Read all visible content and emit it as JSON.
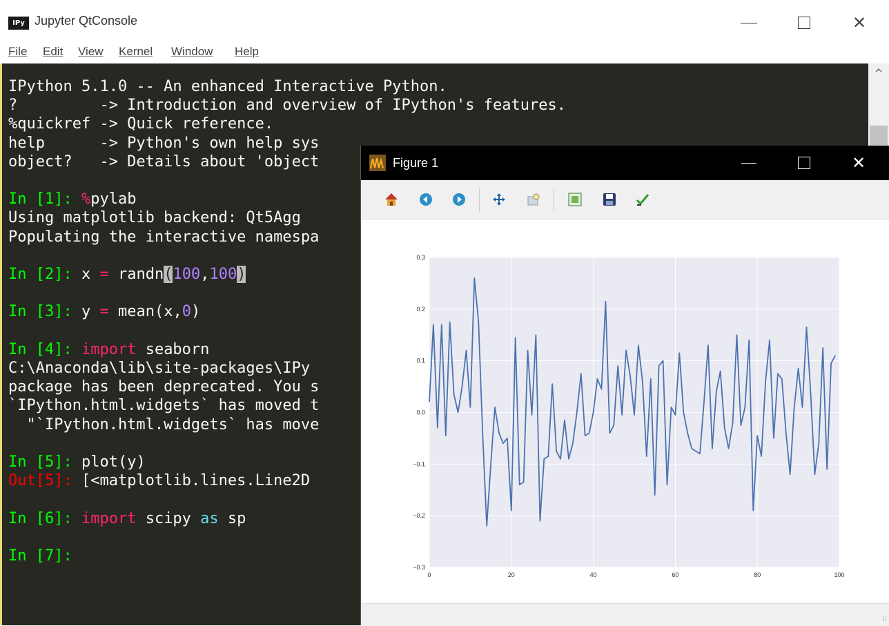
{
  "qtconsole": {
    "title": "Jupyter QtConsole",
    "icon_text": "IPy",
    "menu": [
      "File",
      "Edit",
      "View",
      "Kernel",
      "Window",
      "Help"
    ]
  },
  "console": {
    "banner": [
      "IPython 5.1.0 -- An enhanced Interactive Python.",
      "?         -> Introduction and overview of IPython's features.",
      "%quickref -> Quick reference.",
      "help      -> Python's own help sys",
      "object?   -> Details about 'object"
    ],
    "in1": {
      "prompt": "In [1]: ",
      "magic": "%",
      "code": "pylab"
    },
    "out1": [
      "Using matplotlib backend: Qt5Agg",
      "Populating the interactive namespa"
    ],
    "in2": {
      "prompt": "In [2]: ",
      "var": "x",
      "op": "=",
      "func": "randn",
      "lparen": "(",
      "a": "100",
      "comma": ",",
      "b": "100",
      "rparen": ")"
    },
    "in3": {
      "prompt": "In [3]: ",
      "var": "y",
      "op": "=",
      "call": "mean(x,",
      "arg": "0",
      "close": ")"
    },
    "in4": {
      "prompt": "In [4]: ",
      "kw": "import",
      "mod": " seaborn"
    },
    "out4": [
      "C:\\Anaconda\\lib\\site-packages\\IPy",
      "package has been deprecated. You s",
      "`IPython.html.widgets` has moved t",
      "  \"`IPython.html.widgets` has move"
    ],
    "in5": {
      "prompt": "In [5]: ",
      "code": "plot(y)"
    },
    "out5": {
      "prompt": "Out[5]: ",
      "text": "[<matplotlib.lines.Line2D"
    },
    "in6": {
      "prompt": "In [6]: ",
      "kw": "import",
      "mod": " scipy ",
      "as": "as",
      "alias": " sp"
    },
    "in7": {
      "prompt": "In [7]: "
    }
  },
  "figure": {
    "title": "Figure 1",
    "toolbar": [
      "home-icon",
      "back-icon",
      "forward-icon",
      "pan-icon",
      "zoom-icon",
      "subplots-icon",
      "save-icon",
      "customize-icon"
    ]
  },
  "chart_data": {
    "type": "line",
    "xlim": [
      0,
      100
    ],
    "ylim": [
      -0.3,
      0.3
    ],
    "xticks": [
      "0",
      "20",
      "40",
      "60",
      "80",
      "100"
    ],
    "yticks": [
      "0.3",
      "0.2",
      "0.1",
      "0.0",
      "−0.1",
      "−0.2",
      "−0.3"
    ],
    "grid": true,
    "series": [
      {
        "color": "#4c72b0",
        "values": [
          0.02,
          0.17,
          -0.03,
          0.17,
          -0.045,
          0.175,
          0.035,
          0.0,
          0.05,
          0.12,
          0.01,
          0.26,
          0.175,
          -0.04,
          -0.22,
          -0.1,
          0.01,
          -0.04,
          -0.06,
          -0.05,
          -0.19,
          0.145,
          -0.14,
          -0.135,
          0.12,
          -0.005,
          0.15,
          -0.21,
          -0.09,
          -0.085,
          0.055,
          -0.075,
          -0.09,
          -0.015,
          -0.09,
          -0.06,
          0.0,
          0.075,
          -0.045,
          -0.04,
          0.0,
          0.065,
          0.045,
          0.215,
          -0.04,
          -0.025,
          0.09,
          -0.005,
          0.12,
          0.07,
          -0.005,
          0.13,
          0.06,
          -0.085,
          0.065,
          -0.16,
          0.09,
          0.1,
          -0.14,
          0.01,
          -0.005,
          0.115,
          0.0,
          -0.04,
          -0.07,
          -0.075,
          -0.08,
          0.02,
          0.13,
          -0.07,
          0.04,
          0.08,
          -0.03,
          -0.07,
          -0.02,
          0.15,
          -0.025,
          0.01,
          0.14,
          -0.19,
          -0.045,
          -0.085,
          0.06,
          0.14,
          -0.05,
          0.075,
          0.065,
          -0.04,
          -0.12,
          0.01,
          0.085,
          0.01,
          0.165,
          0.04,
          -0.12,
          -0.06,
          0.125,
          -0.11,
          0.095,
          0.11
        ]
      }
    ]
  }
}
